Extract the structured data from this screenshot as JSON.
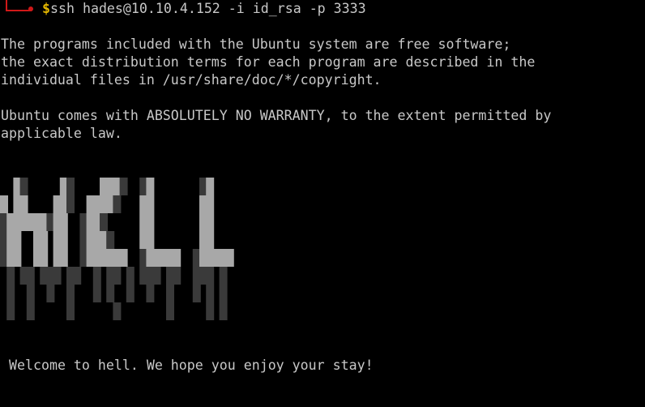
{
  "prompt": {
    "symbol": "$",
    "command": "ssh hades@10.10.4.152 -i id_rsa -p 3333"
  },
  "motd": {
    "line1": "The programs included with the Ubuntu system are free software;",
    "line2": "the exact distribution terms for each program are described in the",
    "line3": "individual files in /usr/share/doc/*/copyright.",
    "line4": "Ubuntu comes with ABSOLUTELY NO WARRANTY, to the extent permitted by",
    "line5": "applicable law."
  },
  "banner": {
    "text": "HELL"
  },
  "welcome": "Welcome to hell. We hope you enjoy your stay!",
  "colors": {
    "background": "#000000",
    "text": "#c8c8c8",
    "prompt_tree": "#d01818",
    "prompt_symbol": "#e6b800"
  }
}
